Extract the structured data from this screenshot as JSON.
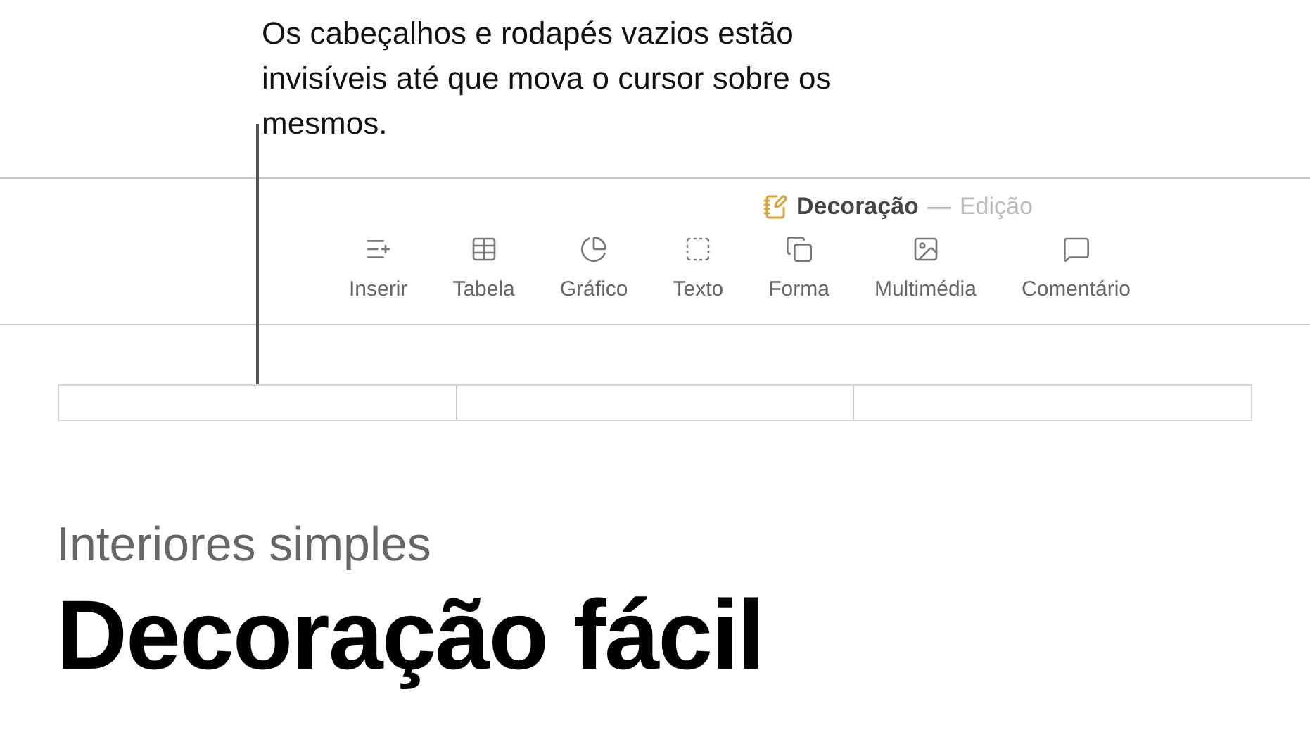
{
  "callout": {
    "text": "Os cabeçalhos e rodapés vazios estão invisíveis até que mova o cursor sobre os mesmos."
  },
  "window": {
    "document_title": "Decoração",
    "separator": "—",
    "mode": "Edição"
  },
  "toolbar": [
    {
      "kind": "insert",
      "label": "Inserir"
    },
    {
      "kind": "table",
      "label": "Tabela"
    },
    {
      "kind": "chart",
      "label": "Gráfico"
    },
    {
      "kind": "text",
      "label": "Texto"
    },
    {
      "kind": "shape",
      "label": "Forma"
    },
    {
      "kind": "media",
      "label": "Multimédia"
    },
    {
      "kind": "comment",
      "label": "Comentário"
    }
  ],
  "document": {
    "subtitle": "Interiores simples",
    "title": "Decoração fácil"
  }
}
